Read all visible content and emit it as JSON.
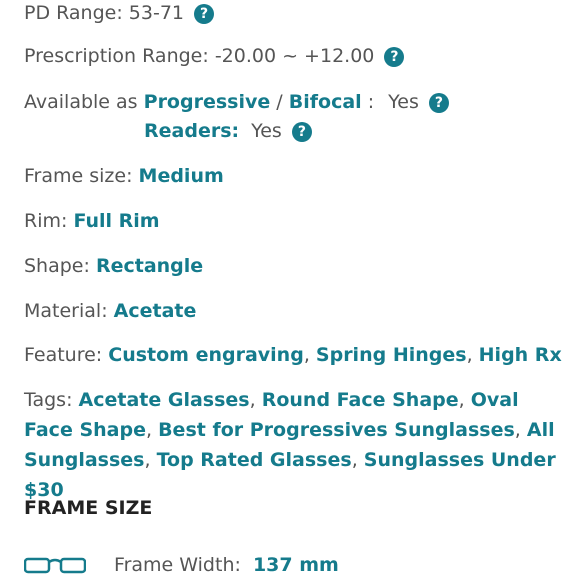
{
  "pd": {
    "label": "PD Range:",
    "value": "53-71"
  },
  "rx": {
    "label": "Prescription Range:",
    "value": "-20.00 ~ +12.00"
  },
  "available": {
    "label": "Available as",
    "progressive": "Progressive",
    "slash": "/",
    "bifocal": "Bifocal",
    "colon": ":",
    "value": "Yes",
    "readers_label": "Readers:",
    "readers_value": "Yes"
  },
  "frame_size": {
    "label": "Frame size:",
    "value": "Medium"
  },
  "rim": {
    "label": "Rim:",
    "value": "Full Rim"
  },
  "shape": {
    "label": "Shape:",
    "value": "Rectangle"
  },
  "material": {
    "label": "Material:",
    "value": "Acetate"
  },
  "feature": {
    "label": "Feature:",
    "items": [
      "Custom engraving",
      "Spring Hinges",
      "High Rx"
    ]
  },
  "tags": {
    "label": "Tags:",
    "items": [
      "Acetate Glasses",
      "Round Face Shape",
      "Oval Face Shape",
      "Best for Progressives Sunglasses",
      "All Sunglasses",
      "Top Rated Glasses",
      "Sunglasses Under $30"
    ]
  },
  "section": {
    "title": "FRAME SIZE"
  },
  "frame_width": {
    "label": "Frame Width:",
    "value": "137 mm",
    "icon": "glasses-icon"
  },
  "help_glyph": "?",
  "separator": ",",
  "colors": {
    "link": "#157b8c",
    "text": "#555555"
  }
}
